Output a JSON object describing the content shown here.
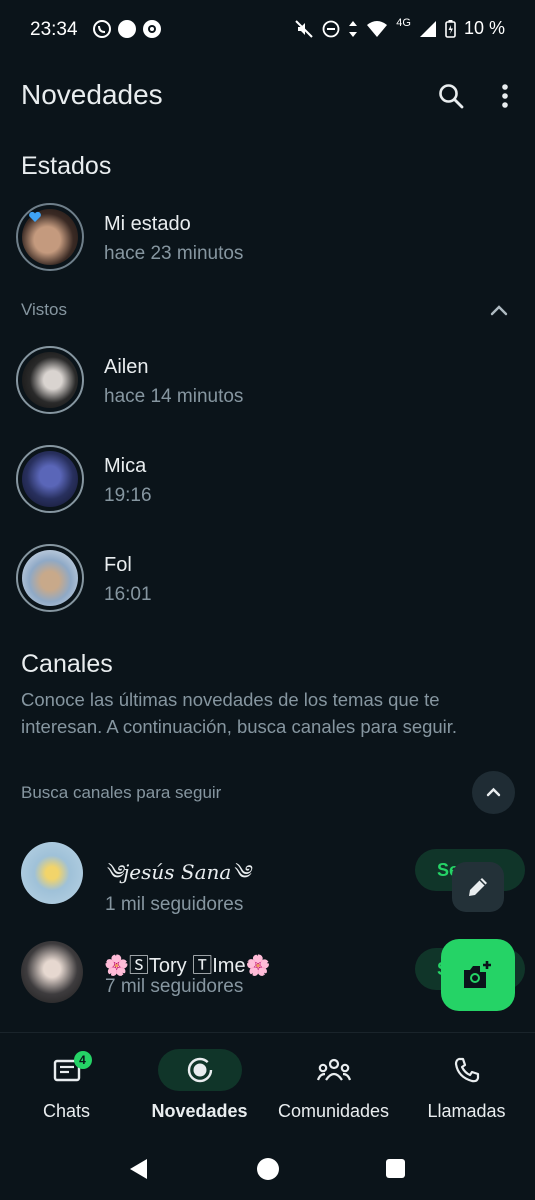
{
  "status_bar": {
    "time": "23:34",
    "battery": "10 %",
    "network": "4G"
  },
  "header": {
    "title": "Novedades",
    "search_icon": "search-icon",
    "menu_icon": "more-vert-icon"
  },
  "estados": {
    "title": "Estados",
    "mine": {
      "name": "Mi estado",
      "time": "hace 23 minutos"
    },
    "seen_label": "Vistos",
    "seen": [
      {
        "name": "Ailen",
        "time": "hace 14 minutos"
      },
      {
        "name": "Mica",
        "time": "19:16"
      },
      {
        "name": "Fol",
        "time": "16:01"
      }
    ]
  },
  "canales": {
    "title": "Canales",
    "description": "Conoce las últimas novedades de los temas que te interesan. A continuación, busca canales para seguir.",
    "find_label": "Busca canales para seguir",
    "channels": [
      {
        "name": "༄jesús Sana༄",
        "followers": "1 mil seguidores",
        "follow_label": "Se"
      },
      {
        "name": "🌸🅂Tory 🅃Ime🌸",
        "followers": "7 mil seguidores",
        "follow_label": "S"
      }
    ]
  },
  "bottom_nav": {
    "items": [
      {
        "label": "Chats",
        "badge": "4",
        "icon": "chat-icon"
      },
      {
        "label": "Novedades",
        "icon": "status-icon",
        "active": true
      },
      {
        "label": "Comunidades",
        "icon": "communities-icon"
      },
      {
        "label": "Llamadas",
        "icon": "phone-icon"
      }
    ]
  },
  "colors": {
    "background": "#0b141a",
    "accent": "#25d366",
    "muted": "#8696a0"
  }
}
